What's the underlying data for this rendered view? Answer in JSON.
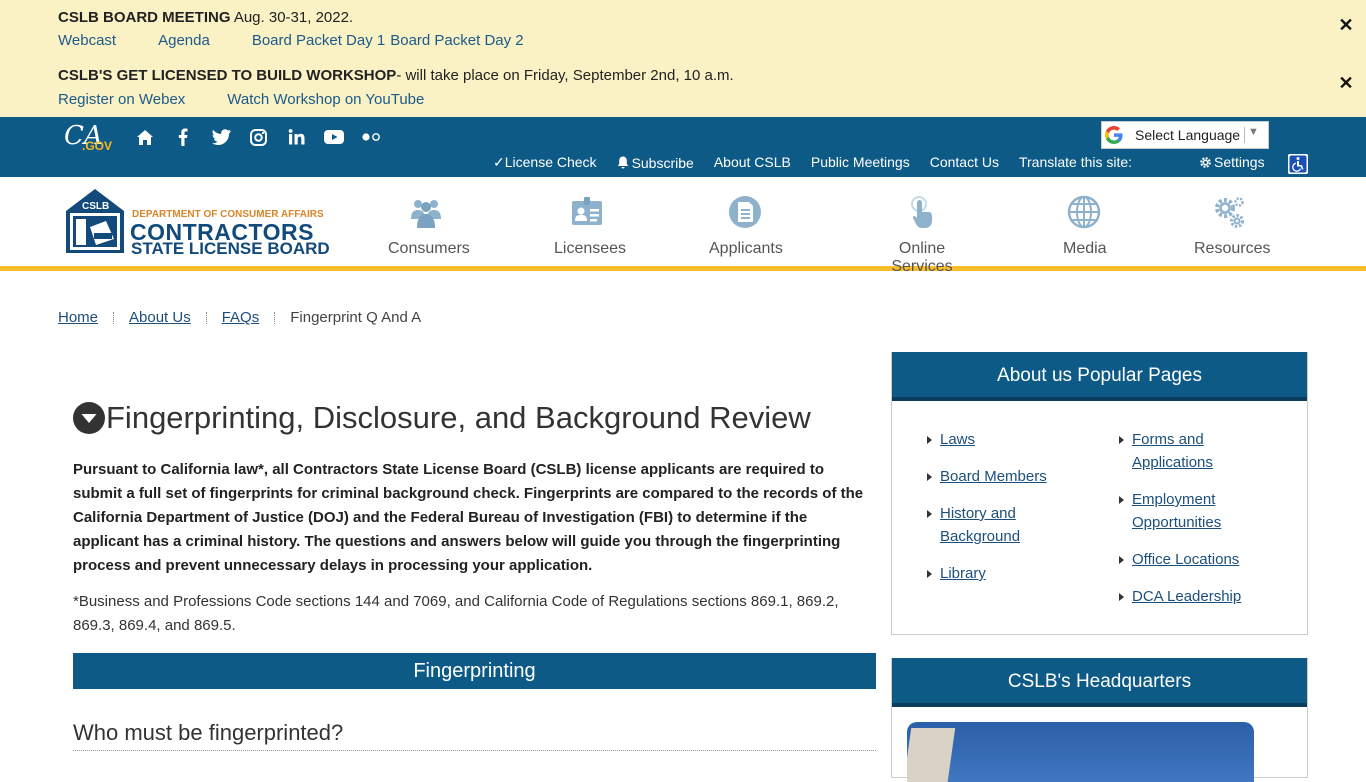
{
  "alerts": [
    {
      "title": "CSLB BOARD MEETING",
      "text": " Aug. 30-31, 2022.",
      "links": [
        "Webcast",
        "Agenda",
        "Board Packet Day 1",
        "Board Packet Day 2"
      ]
    },
    {
      "title": "CSLB'S GET LICENSED TO BUILD WORKSHOP",
      "text": "- will take place on Friday, September 2nd, 10 a.m.",
      "links": [
        "Register on Webex",
        "Watch Workshop on YouTube"
      ]
    }
  ],
  "utility": {
    "ca_logo": "CA",
    "ca_gov": ".GOV",
    "social_icons": [
      "home-icon",
      "facebook-icon",
      "twitter-icon",
      "instagram-icon",
      "linkedin-icon",
      "youtube-icon",
      "flickr-icon"
    ],
    "links": [
      "✓License Check",
      "Subscribe",
      "About CSLB",
      "Public Meetings",
      "Contact Us",
      "Translate this site:"
    ],
    "language": "Select Language",
    "settings": "Settings"
  },
  "header": {
    "logo_line1": "DEPARTMENT OF CONSUMER AFFAIRS",
    "logo_line2": "CONTRACTORS",
    "logo_line3": "STATE LICENSE BOARD",
    "logo_badge": "CSLB",
    "nav": [
      {
        "label": "Consumers",
        "icon": "people-icon"
      },
      {
        "label": "Licensees",
        "icon": "id-card-icon"
      },
      {
        "label": "Applicants",
        "icon": "document-icon"
      },
      {
        "label": "Online Services",
        "icon": "hand-pointer-icon"
      },
      {
        "label": "Media",
        "icon": "globe-icon"
      },
      {
        "label": "Resources",
        "icon": "gears-icon"
      }
    ]
  },
  "breadcrumb": [
    "Home",
    "About Us",
    "FAQs",
    "Fingerprint Q And A"
  ],
  "main": {
    "title": "Fingerprinting, Disclosure, and Background Review",
    "intro": "Pursuant to California law*, all Contractors State License Board (CSLB) license applicants are required to submit a full set of fingerprints for criminal background check. Fingerprints are compared to the records of the California Department of Justice (DOJ) and the Federal Bureau of Investigation (FBI) to determine if the applicant has a criminal history. The questions and answers below will guide you through the fingerprinting process and prevent unnecessary delays in processing your application.",
    "footnote": "*Business and Professions Code sections 144 and 7069, and California Code of Regulations sections 869.1, 869.2, 869.3, 869.4, and 869.5.",
    "section": "Fingerprinting",
    "question": "Who must be fingerprinted?"
  },
  "sidebar": {
    "popular_title": "About us Popular Pages",
    "popular_left": [
      "Laws",
      "Board Members",
      "History and Background",
      "Library"
    ],
    "popular_right": [
      "Forms and Applications",
      "Employment Opportunities",
      "Office Locations",
      "DCA Leadership"
    ],
    "hq_title": "CSLB's Headquarters"
  },
  "colors": {
    "banner": "#faf1c5",
    "primary": "#0d5a86",
    "accent": "#f7bd2a"
  }
}
